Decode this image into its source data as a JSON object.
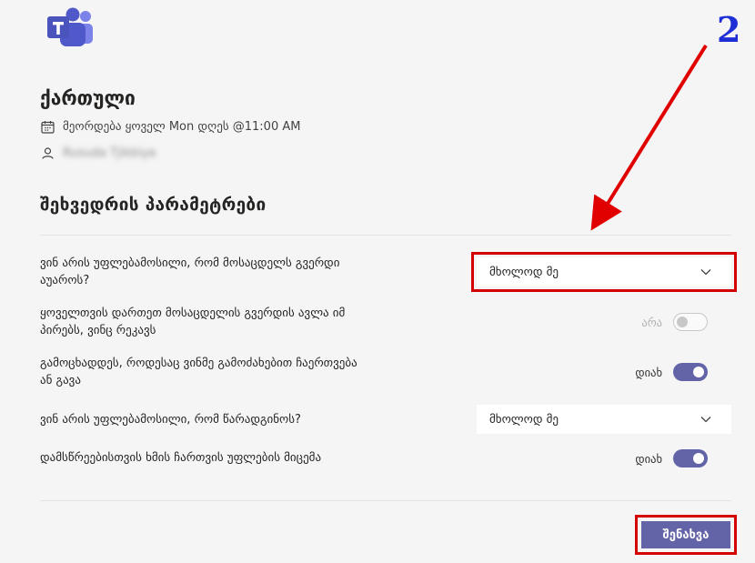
{
  "app": {
    "name": "Microsoft Teams"
  },
  "annotation": {
    "step_number": "2"
  },
  "meeting": {
    "title": "ქართული",
    "recurrence": "მეორდება ყოველ Mon დღეს @11:00 AM",
    "organizer": "Rusuda Tjikbiya"
  },
  "options": {
    "heading": "შეხვედრის პარამეტრები",
    "bypass_lobby": {
      "label": "ვინ არის უფლებამოსილი, რომ მოსაცდელს გვერდი აუაროს?",
      "value": "მხოლოდ მე"
    },
    "callers_bypass": {
      "label": "ყოველთვის დართეთ მოსაცდელის გვერდის ავლა იმ პირებს, ვინც რეკავს",
      "state": "არა",
      "enabled": false
    },
    "announce_join": {
      "label": "გამოცხადდეს, როდესაც ვინმე გამოძახებით ჩაერთვება ან გავა",
      "state": "დიახ",
      "enabled": true
    },
    "presenters": {
      "label": "ვინ არის უფლებამოსილი, რომ წარადგინოს?",
      "value": "მხოლოდ მე"
    },
    "allow_mic": {
      "label": "დამსწრეებისთვის ხმის ჩართვის უფლების მიცემა",
      "state": "დიახ",
      "enabled": true
    }
  },
  "actions": {
    "save_label": "შენახვა"
  },
  "colors": {
    "accent": "#6264a7",
    "highlight": "#d40000",
    "annotation_number": "#1f2fd6"
  }
}
